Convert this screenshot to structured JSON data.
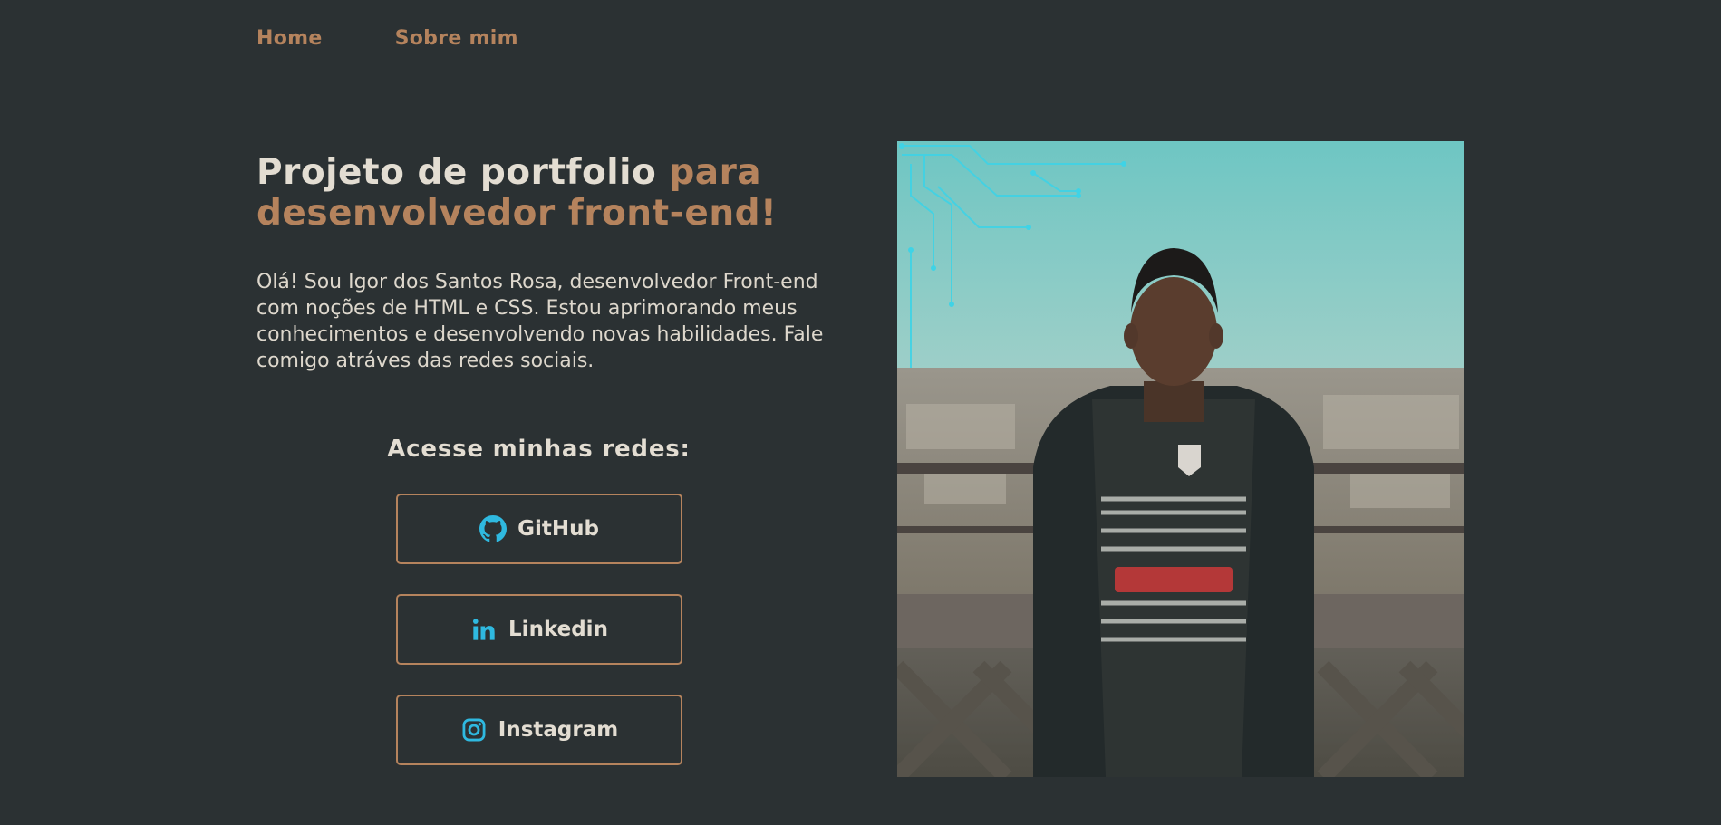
{
  "nav": {
    "items": [
      {
        "label": "Home"
      },
      {
        "label": "Sobre mim"
      }
    ]
  },
  "hero": {
    "title_part1": "Projeto de portfolio ",
    "title_part2": "para desenvolvedor front-end!",
    "description": "Olá! Sou Igor dos Santos Rosa, desenvolvedor Front-end com noções de HTML e CSS. Estou aprimorando meus conhecimentos e desenvolvendo novas habilidades. Fale comigo atráves das redes sociais."
  },
  "social": {
    "title": "Acesse minhas redes:",
    "buttons": [
      {
        "label": "GitHub",
        "icon": "github-icon"
      },
      {
        "label": "Linkedin",
        "icon": "linkedin-icon"
      },
      {
        "label": "Instagram",
        "icon": "instagram-icon"
      }
    ]
  },
  "photo": {
    "alt": "portrait-photo"
  },
  "colors": {
    "background": "#2b3133",
    "accent": "#b5835d",
    "text": "#e3ddd2",
    "icon": "#2fb9e0"
  }
}
